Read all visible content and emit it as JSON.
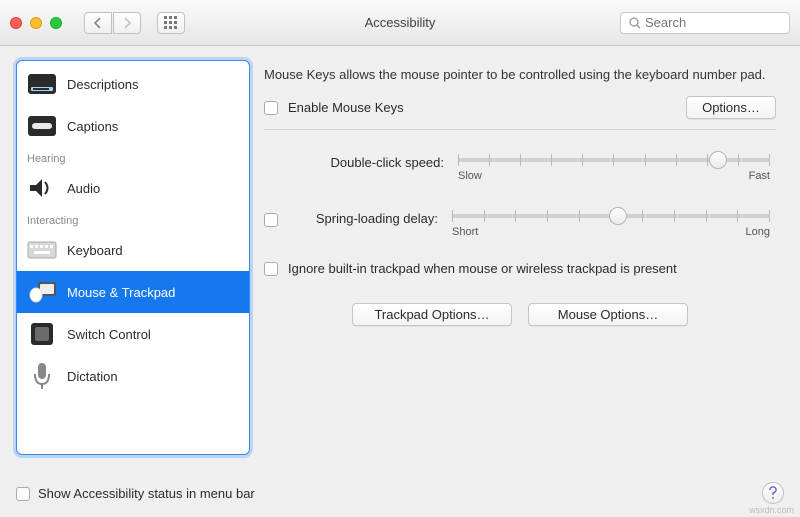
{
  "window": {
    "title": "Accessibility",
    "search_placeholder": "Search"
  },
  "sidebar": {
    "items": [
      {
        "label": "Descriptions"
      },
      {
        "label": "Captions"
      }
    ],
    "hearing_header": "Hearing",
    "hearing_items": [
      {
        "label": "Audio"
      }
    ],
    "interacting_header": "Interacting",
    "interacting_items": [
      {
        "label": "Keyboard"
      },
      {
        "label": "Mouse & Trackpad"
      },
      {
        "label": "Switch Control"
      },
      {
        "label": "Dictation"
      }
    ]
  },
  "detail": {
    "help_text": "Mouse Keys allows the mouse pointer to be controlled using the keyboard number pad.",
    "enable_mouse_keys": "Enable Mouse Keys",
    "options": "Options…",
    "double_click_label": "Double-click speed:",
    "double_click_min": "Slow",
    "double_click_max": "Fast",
    "spring_label": "Spring-loading delay:",
    "spring_min": "Short",
    "spring_max": "Long",
    "ignore_trackpad": "Ignore built-in trackpad when mouse or wireless trackpad is present",
    "trackpad_options": "Trackpad Options…",
    "mouse_options": "Mouse Options…"
  },
  "footer": {
    "show_status": "Show Accessibility status in menu bar"
  },
  "misc": {
    "watermark": "wsxdn.com"
  }
}
